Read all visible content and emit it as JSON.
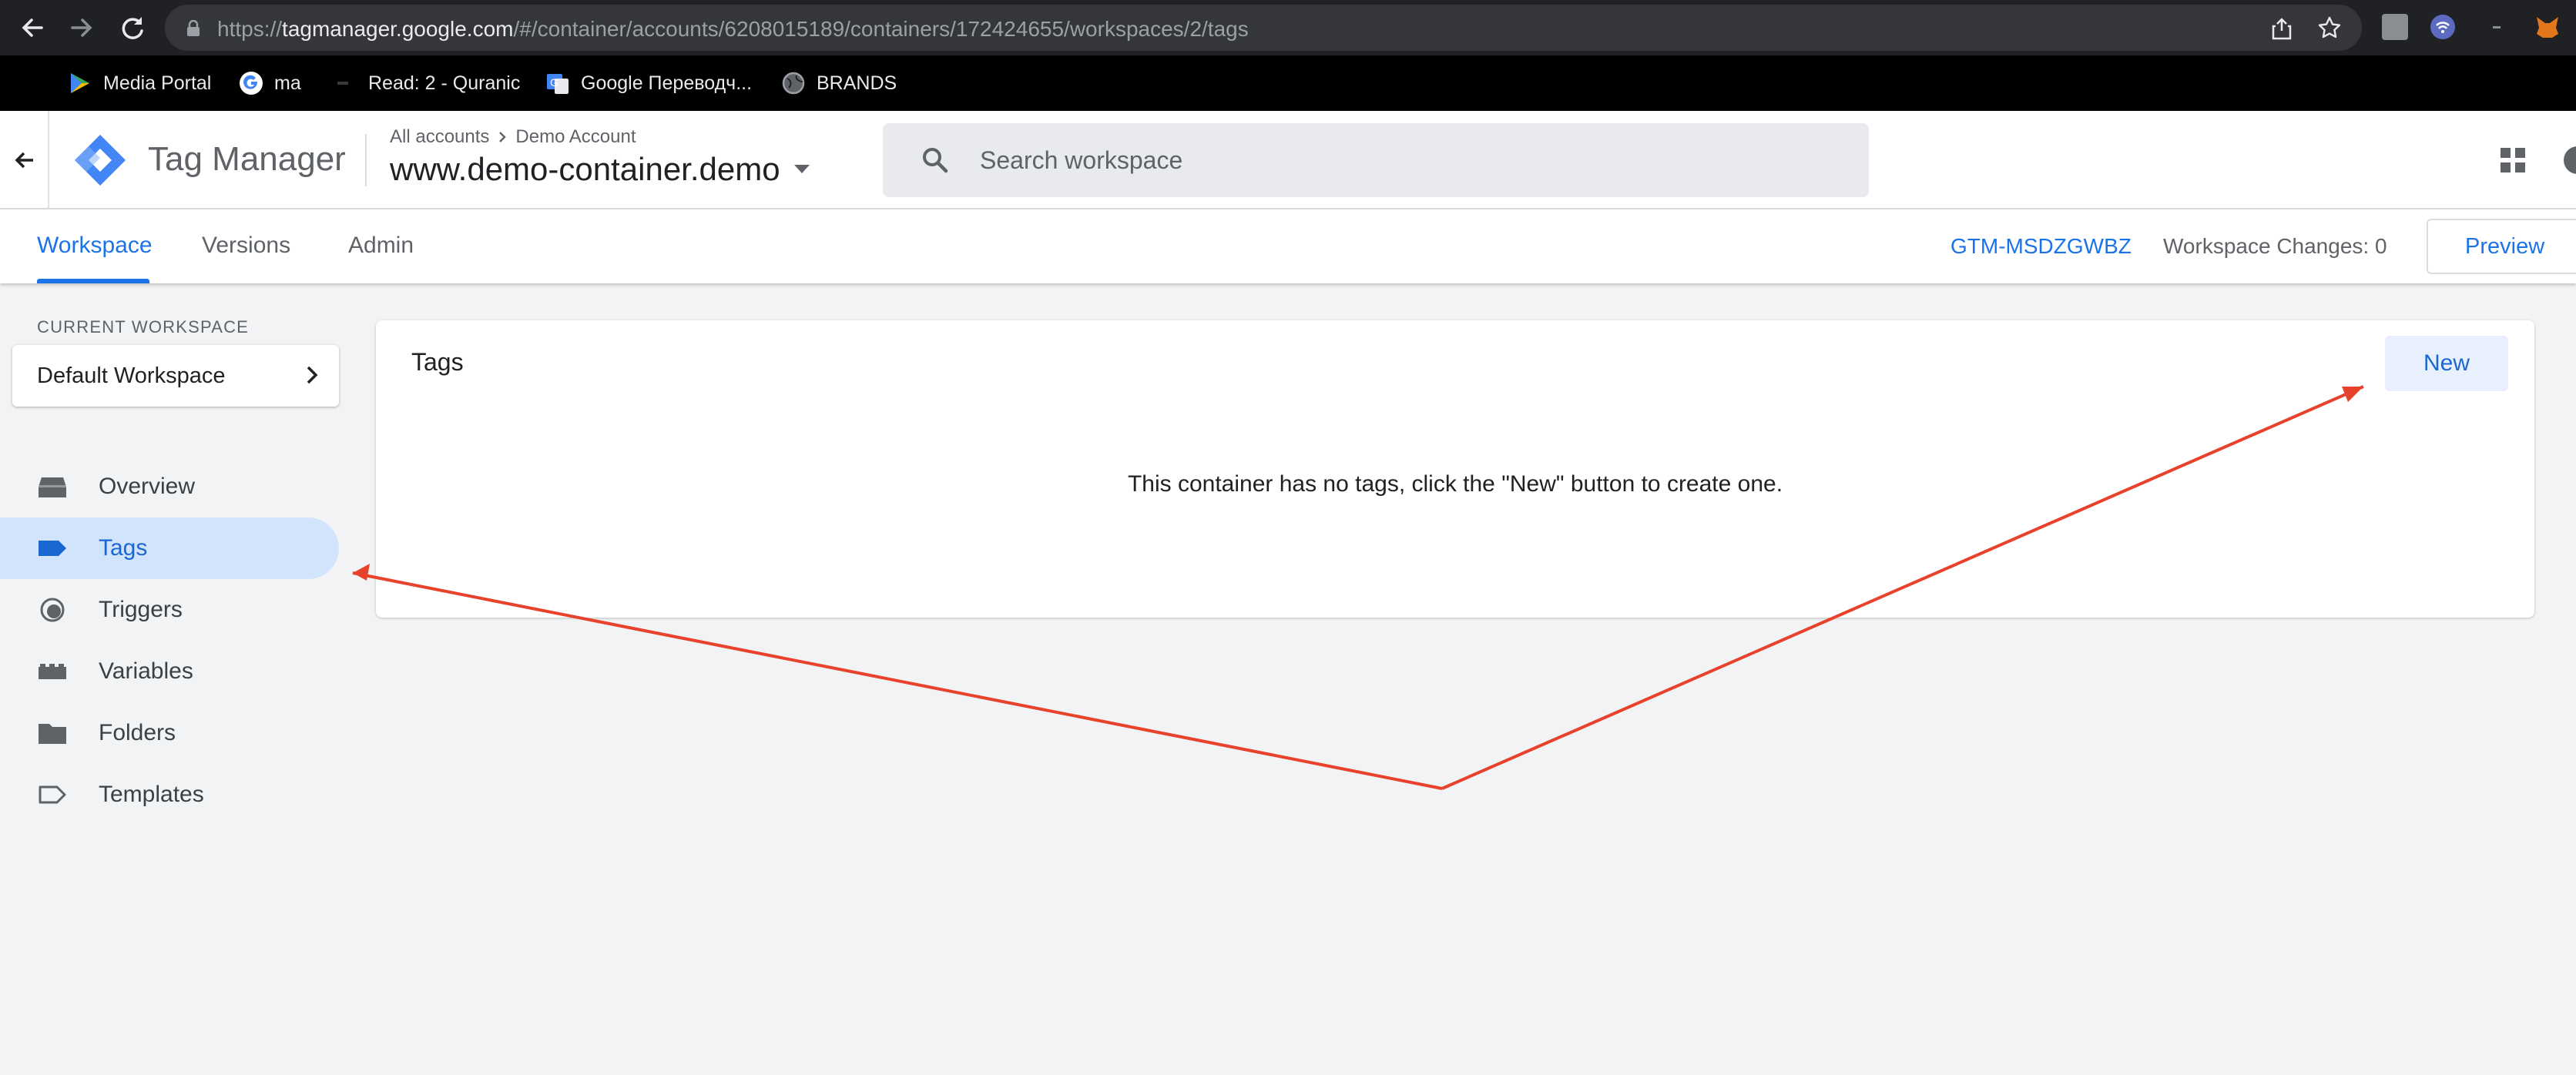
{
  "browser": {
    "url_prefix": "https://",
    "url_domain": "tagmanager.google.com",
    "url_path": "/#/container/accounts/6208015189/containers/172424655/workspaces/2/tags",
    "bookmarks": [
      {
        "label": "Media Portal",
        "icon": "play-triangle-icon"
      },
      {
        "label": "ma",
        "icon": "google-g-icon"
      },
      {
        "label": "Read: 2 - Quranic",
        "icon": "book-icon"
      },
      {
        "label": "Google Переводч...",
        "icon": "translate-icon"
      },
      {
        "label": "BRANDS",
        "icon": "globe-icon"
      }
    ]
  },
  "header": {
    "product_name": "Tag Manager",
    "breadcrumb": {
      "parent": "All accounts",
      "account": "Demo Account"
    },
    "container_name": "www.demo-container.demo",
    "search_placeholder": "Search workspace"
  },
  "tabs": {
    "items": [
      {
        "label": "Workspace",
        "active": true
      },
      {
        "label": "Versions",
        "active": false
      },
      {
        "label": "Admin",
        "active": false
      }
    ],
    "container_id": "GTM-MSDZGWBZ",
    "workspace_changes": "Workspace Changes: 0",
    "preview_label": "Preview"
  },
  "sidebar": {
    "current_workspace_label": "CURRENT WORKSPACE",
    "workspace_name": "Default Workspace",
    "items": [
      {
        "label": "Overview",
        "icon": "overview-icon",
        "active": false
      },
      {
        "label": "Tags",
        "icon": "tag-icon",
        "active": true
      },
      {
        "label": "Triggers",
        "icon": "trigger-icon",
        "active": false
      },
      {
        "label": "Variables",
        "icon": "variables-icon",
        "active": false
      },
      {
        "label": "Folders",
        "icon": "folder-icon",
        "active": false
      },
      {
        "label": "Templates",
        "icon": "template-icon",
        "active": false
      }
    ]
  },
  "main": {
    "title": "Tags",
    "new_button": "New",
    "empty_message": "This container has no tags, click the \"New\" button to create one."
  },
  "colors": {
    "accent_blue": "#1a73e8",
    "active_nav_bg": "#d2e3fc",
    "annotation_arrow": "#e8412c",
    "page_bg": "#f1f3f4"
  }
}
